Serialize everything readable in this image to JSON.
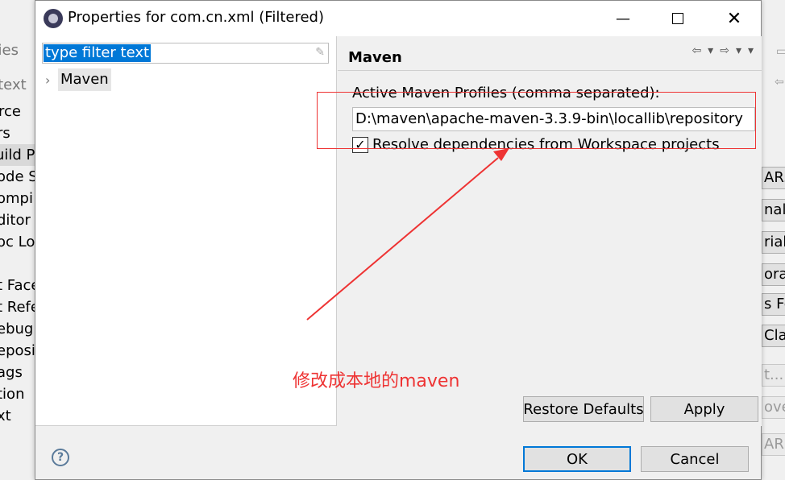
{
  "background_left": {
    "title": "erties",
    "filter": "r text",
    "items": [
      "rce",
      "rs",
      "uild P",
      "ode S",
      "ompi",
      "ditor",
      "oc Loc",
      "",
      "t Face",
      "t Refe",
      "ebug",
      "eposi",
      "ags",
      "tion",
      "xt"
    ]
  },
  "background_right": {
    "buttons": [
      "ARs",
      "nal .",
      "riab",
      "orar",
      "s Fo",
      "Clas",
      "t...",
      "ove",
      "AR"
    ]
  },
  "dialog": {
    "title": "Properties for com.cn.xml (Filtered)",
    "filter_placeholder": "type filter text",
    "tree": [
      {
        "label": "Maven"
      }
    ],
    "page": {
      "title": "Maven",
      "profiles_label": "Active Maven Profiles (comma separated):",
      "profiles_value": "D:\\maven\\apache-maven-3.3.9-bin\\locallib\\repository",
      "resolve_label": "Resolve dependencies from Workspace projects",
      "resolve_checked": true
    },
    "buttons": {
      "restore_defaults": "Restore Defaults",
      "apply": "Apply",
      "ok": "OK",
      "cancel": "Cancel"
    }
  },
  "annotation": {
    "text": "修改成本地的maven",
    "color": "#ee3333"
  },
  "colors": {
    "selection": "#0078d7",
    "accent": "#0078d7"
  }
}
